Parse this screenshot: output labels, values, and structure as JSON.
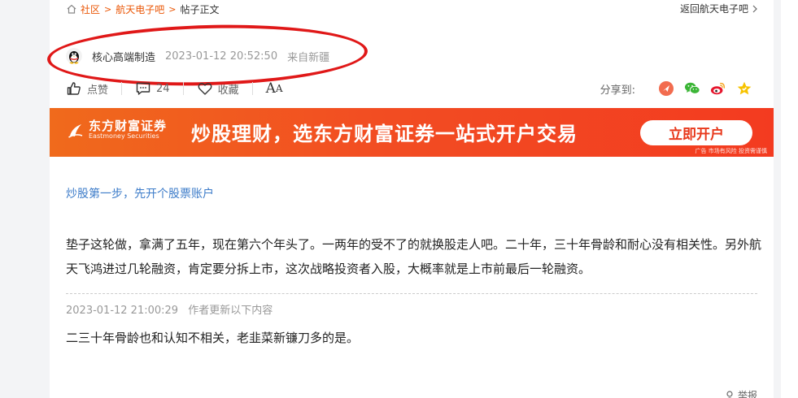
{
  "breadcrumb": {
    "items": [
      "社区",
      "航天电子吧"
    ],
    "current": "帖子正文",
    "separator": ">"
  },
  "back_link": "返回航天电子吧",
  "post": {
    "author": "核心高端制造",
    "time": "2023-01-12 20:52:50",
    "from": "来自新疆",
    "body": "垫子这轮做，拿满了五年，现在第六个年头了。一两年的受不了的就换股走人吧。二十年，三十年骨龄和耐心没有相关性。另外航天飞鸿进过几轮融资，肯定要分拆上市，这次战略投资者入股，大概率就是上市前最后一轮融资。"
  },
  "actions": {
    "like_label": "点赞",
    "comment_count": "24",
    "favorite_label": "收藏",
    "font_big": "A",
    "font_small": "A"
  },
  "share": {
    "label": "分享到:",
    "targets": [
      "share-icon-orange",
      "wechat-icon",
      "weibo-icon",
      "star-icon"
    ]
  },
  "banner": {
    "brand": "东方财富证券",
    "brand_en": "Eastmoney Securities",
    "slogan": "炒股理财，选东方财富证券一站式开户交易",
    "cta": "立即开户",
    "disclaimer": "广告 市场有风险 投资需谨慎"
  },
  "promo_link": "炒股第一步，先开个股票账户",
  "update": {
    "time": "2023-01-12 21:00:29",
    "label": "作者更新以下内容",
    "body": "二三十年骨龄也和认知不相关，老韭菜新镰刀多的是。"
  },
  "report_label": "举报",
  "colors": {
    "accent": "#ea5504",
    "link_blue": "#3d7cc9",
    "annotation_red": "#e01818",
    "banner_orange": "#f24d22"
  }
}
